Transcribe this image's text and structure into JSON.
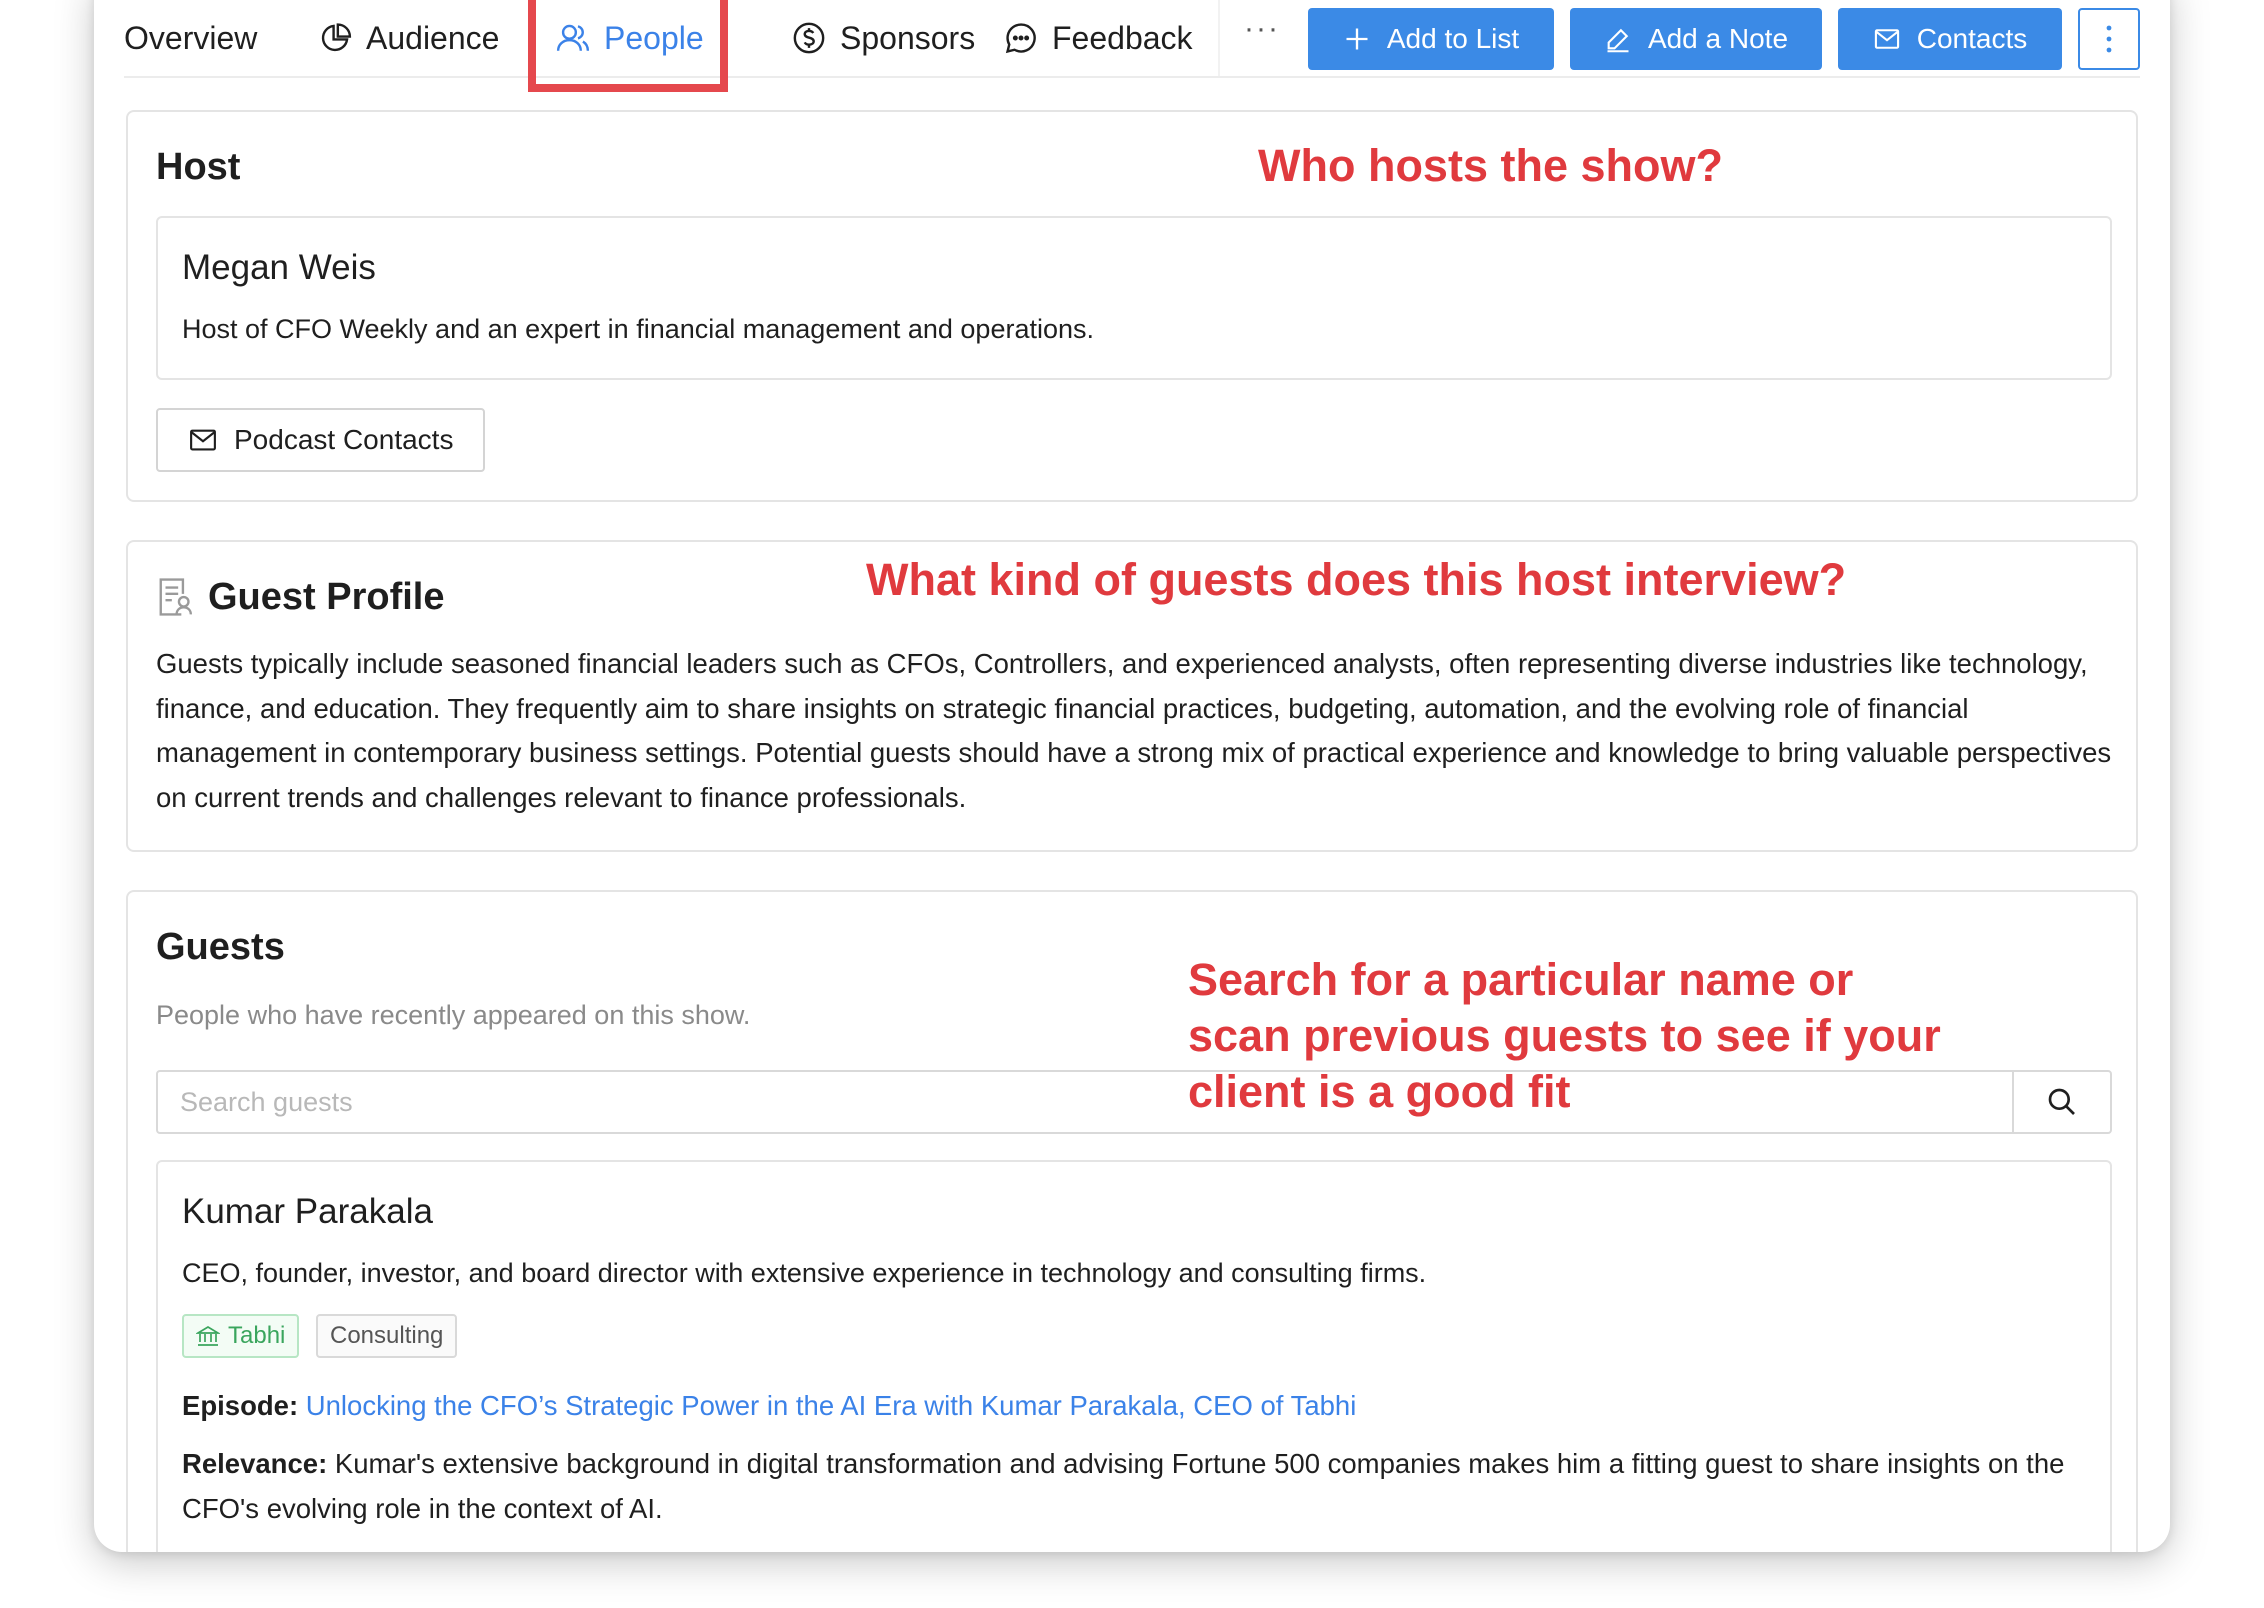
{
  "tabs": [
    {
      "label": "Overview",
      "icon": "none"
    },
    {
      "label": "Audience",
      "icon": "pie-chart-icon"
    },
    {
      "label": "People",
      "icon": "people-icon",
      "active": true
    },
    {
      "label": "Sponsors",
      "icon": "dollar-circle-icon"
    },
    {
      "label": "Feedback",
      "icon": "chat-bubble-icon"
    }
  ],
  "toolbar": {
    "more_label": "···",
    "add_to_list_label": "Add to List",
    "add_note_label": "Add a Note",
    "contacts_label": "Contacts"
  },
  "host": {
    "title": "Host",
    "annotation": "Who hosts the show?",
    "name": "Megan Weis",
    "description": "Host of CFO Weekly and an expert in financial management and operations.",
    "contacts_button": "Podcast Contacts"
  },
  "guest_profile": {
    "title": "Guest Profile",
    "annotation": "What kind of guests does this host interview?",
    "text": "Guests typically include seasoned financial leaders such as CFOs, Controllers, and experienced analysts, often representing diverse industries like technology, finance, and education. They frequently aim to share insights on strategic financial practices, budgeting, automation, and the evolving role of financial management in contemporary business settings. Potential guests should have a strong mix of practical experience and knowledge to bring valuable perspectives on current trends and challenges relevant to finance professionals."
  },
  "guests": {
    "title": "Guests",
    "subtitle": "People who have recently appeared on this show.",
    "annotation_lines": [
      "Search for a particular name or",
      "scan previous guests to see if your",
      "client is a good fit"
    ],
    "search_placeholder": "Search guests",
    "items": [
      {
        "name": "Kumar Parakala",
        "description": "CEO, founder, investor, and board director with extensive experience in technology and consulting firms.",
        "company_tag": "Tabhi",
        "industry_tag": "Consulting",
        "episode_label": "Episode:",
        "episode_title": "Unlocking the CFO’s Strategic Power in the AI Era with Kumar Parakala, CEO of Tabhi",
        "relevance_label": "Relevance:",
        "relevance_text": "Kumar's extensive background in digital transformation and advising Fortune 500 companies makes him a fitting guest to share insights on the CFO's evolving role in the context of AI."
      }
    ]
  },
  "colors": {
    "accent": "#3b8ae6",
    "annotation": "#e03a3e",
    "tag_green": "#3aa55d"
  }
}
